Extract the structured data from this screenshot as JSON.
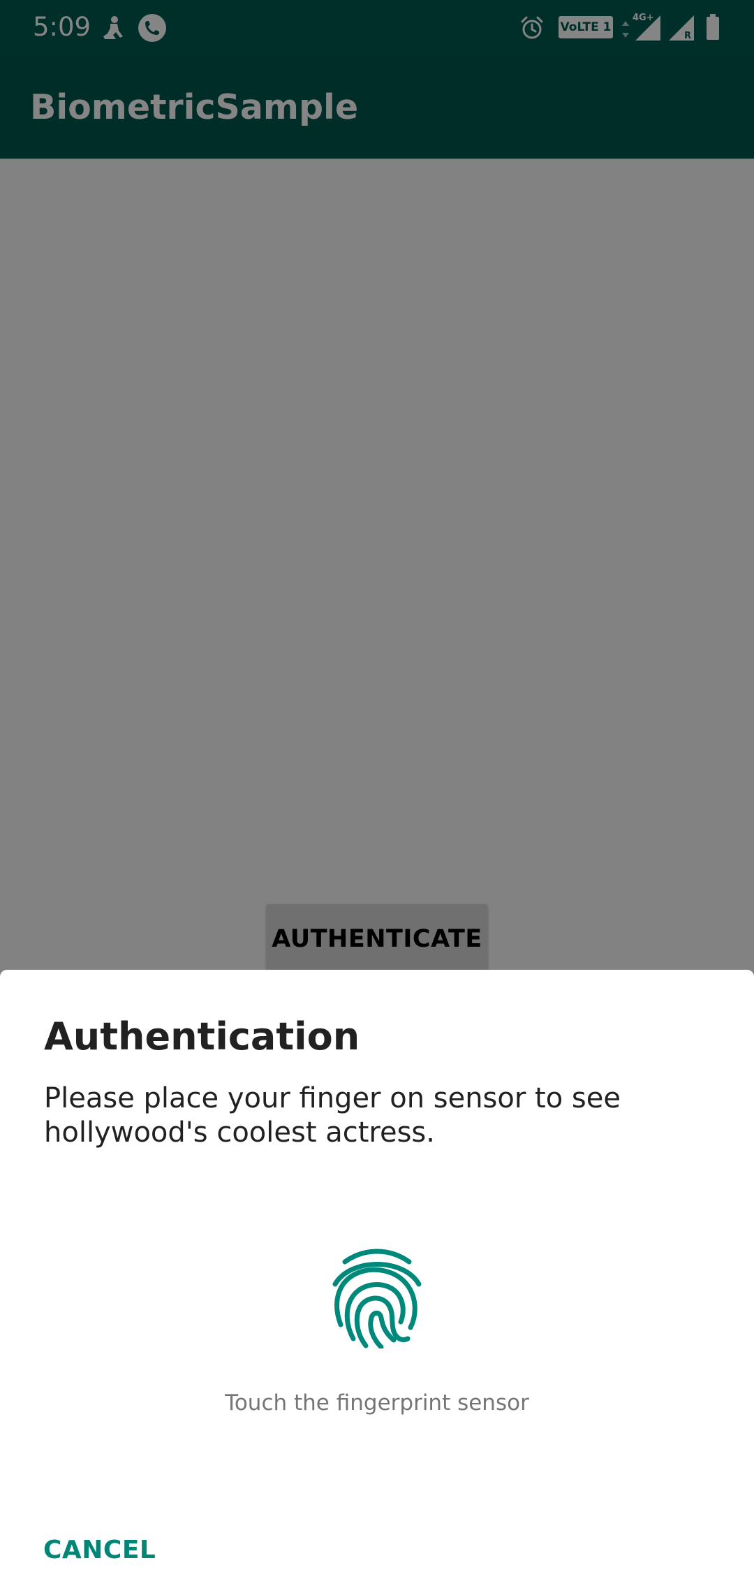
{
  "status_bar": {
    "time": "5:09",
    "volte_label": "VoLTE 1",
    "network_type": "4G+",
    "roaming_indicator": "R",
    "background_color": "#015b4f",
    "icons": [
      "notification-app-icon",
      "phone-call-icon",
      "alarm-icon",
      "volte-badge-icon",
      "data-arrows-icon",
      "signal-strength-icon",
      "roaming-signal-icon",
      "battery-icon"
    ]
  },
  "app_bar": {
    "title": "BiometricSample",
    "background_color": "#00574b"
  },
  "main": {
    "authenticate_label": "AUTHENTICATE"
  },
  "dialog": {
    "title": "Authentication",
    "description": "Please place your finger on sensor to see hollywood's coolest actress.",
    "fingerprint_icon": "fingerprint-icon",
    "fingerprint_color": "#00897b",
    "hint": "Touch the fingerprint sensor",
    "cancel_label": "CANCEL",
    "accent_color": "#008577"
  }
}
